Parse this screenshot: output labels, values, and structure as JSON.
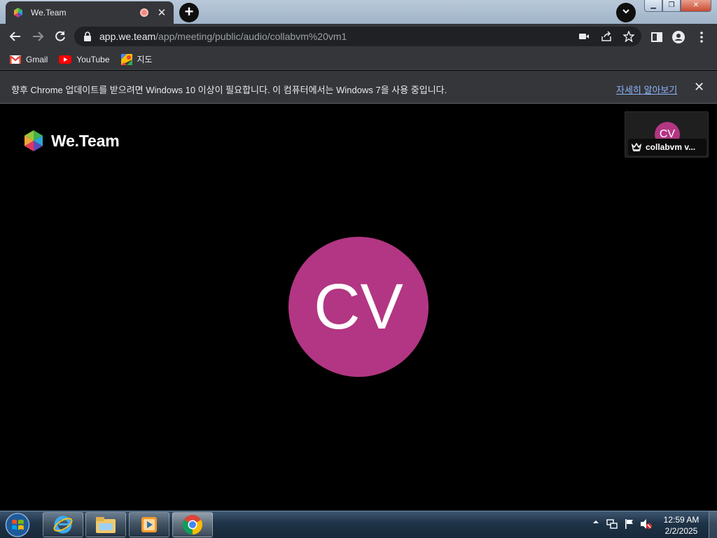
{
  "browser": {
    "tab_title": "We.Team",
    "url_host": "app.we.team",
    "url_path": "/app/meeting/public/audio/collabvm%20vm1"
  },
  "bookmarks": [
    {
      "label": "Gmail",
      "icon": "gmail-icon"
    },
    {
      "label": "YouTube",
      "icon": "youtube-icon"
    },
    {
      "label": "지도",
      "icon": "maps-icon"
    }
  ],
  "infobar": {
    "message": "향후 Chrome 업데이트를 받으려면 Windows 10 이상이 필요합니다. 이 컴퓨터에서는 Windows 7을 사용 중입니다.",
    "link": "자세히 알아보기"
  },
  "meeting": {
    "logo_text": "We.Team",
    "main_avatar_initials": "CV",
    "avatar_color": "#b23683",
    "tile": {
      "initials": "CV",
      "name": "collabvm v..."
    }
  },
  "taskbar": {
    "apps": [
      "internet-explorer-icon",
      "file-explorer-icon",
      "media-player-icon",
      "chrome-icon"
    ],
    "time": "12:59 AM",
    "date": "2/2/2025"
  }
}
